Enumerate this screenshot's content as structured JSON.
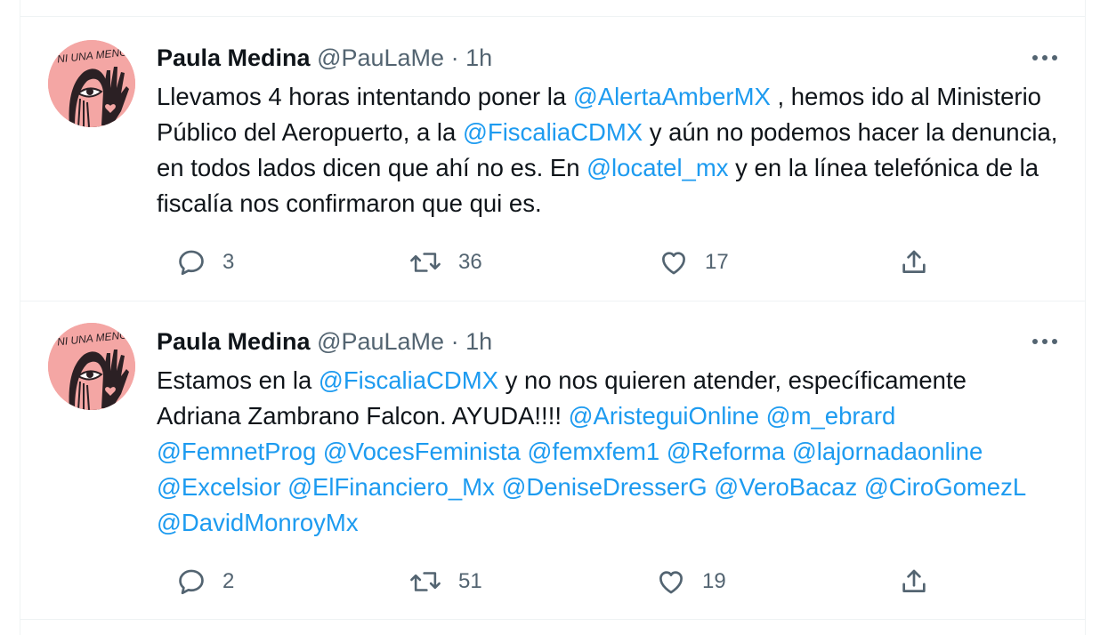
{
  "tweets": [
    {
      "author_name": "Paula Medina",
      "handle": "@PauLaMe",
      "dot": "·",
      "time": "1h",
      "body": [
        {
          "t": "Llevamos 4 horas intentando poner la "
        },
        {
          "t": "@AlertaAmberMX",
          "m": true
        },
        {
          "t": " , hemos ido al Ministerio Público del Aeropuerto, a la "
        },
        {
          "t": "@FiscaliaCDMX",
          "m": true
        },
        {
          "t": " y aún no podemos hacer la denuncia, en todos lados dicen que ahí no es. En "
        },
        {
          "t": "@locatel_mx",
          "m": true
        },
        {
          "t": " y en la línea telefónica de la fiscalía nos confirmaron que qui es."
        }
      ],
      "replies": "3",
      "retweets": "36",
      "likes": "17",
      "avatar_text": "NI UNA MENOS"
    },
    {
      "author_name": "Paula Medina",
      "handle": "@PauLaMe",
      "dot": "·",
      "time": "1h",
      "body": [
        {
          "t": "Estamos en la "
        },
        {
          "t": "@FiscaliaCDMX",
          "m": true
        },
        {
          "t": " y no nos quieren atender, específicamente Adriana Zambrano Falcon. AYUDA!!!! "
        },
        {
          "t": "@AristeguiOnline",
          "m": true
        },
        {
          "t": " "
        },
        {
          "t": "@m_ebrard",
          "m": true
        },
        {
          "t": " "
        },
        {
          "t": "@FemnetProg",
          "m": true
        },
        {
          "t": " "
        },
        {
          "t": "@VocesFeminista",
          "m": true
        },
        {
          "t": " "
        },
        {
          "t": "@femxfem1",
          "m": true
        },
        {
          "t": " "
        },
        {
          "t": "@Reforma",
          "m": true
        },
        {
          "t": " "
        },
        {
          "t": "@lajornadaonline",
          "m": true
        },
        {
          "t": " "
        },
        {
          "t": "@Excelsior",
          "m": true
        },
        {
          "t": " "
        },
        {
          "t": "@ElFinanciero_Mx",
          "m": true
        },
        {
          "t": " "
        },
        {
          "t": "@DeniseDresserG",
          "m": true
        },
        {
          "t": " "
        },
        {
          "t": "@VeroBacaz",
          "m": true
        },
        {
          "t": " "
        },
        {
          "t": "@CiroGomezL",
          "m": true
        },
        {
          "t": " "
        },
        {
          "t": "@DavidMonroyMx",
          "m": true
        }
      ],
      "replies": "2",
      "retweets": "51",
      "likes": "19",
      "avatar_text": "NI UNA MENOS"
    }
  ],
  "icons": {
    "more": "more-horizontal-icon",
    "reply": "reply-icon",
    "retweet": "retweet-icon",
    "like": "heart-icon",
    "share": "share-icon"
  },
  "colors": {
    "mention": "#1d9bf0",
    "secondary_text": "#536471",
    "avatar_bg": "#f4a6a4"
  }
}
